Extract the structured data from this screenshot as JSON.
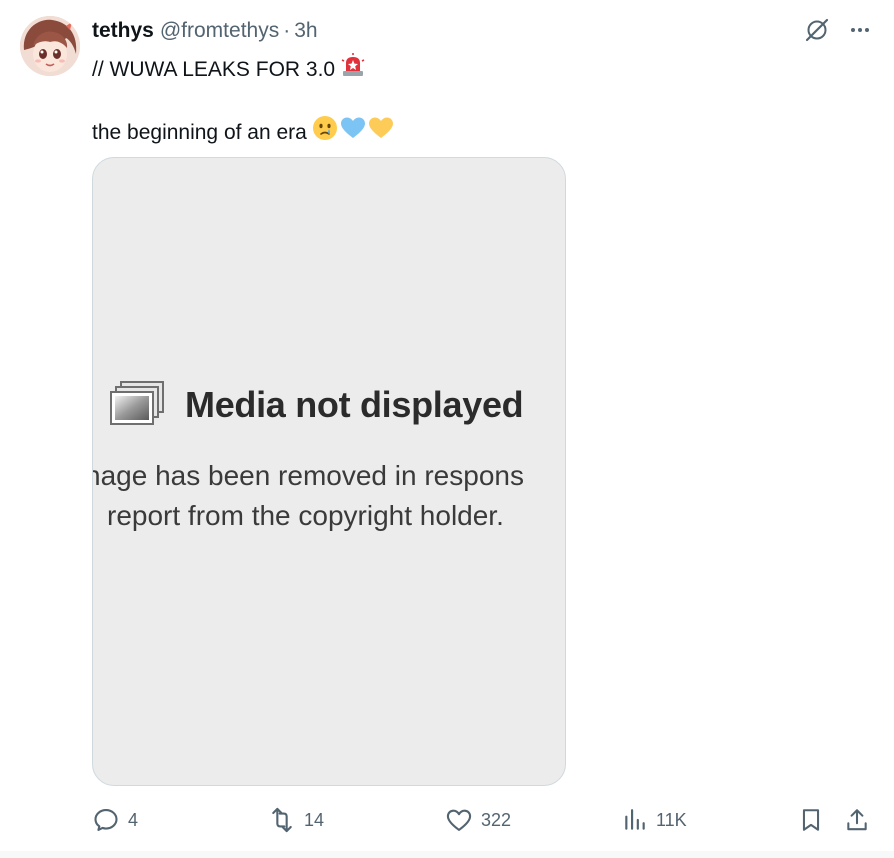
{
  "user": {
    "display_name": "tethys",
    "handle": "@fromtethys",
    "separator": "·",
    "time": "3h",
    "avatar_icon": "anime-avatar"
  },
  "top_actions": {
    "grok_icon": "grok-icon",
    "more_icon": "more-icon"
  },
  "tweet": {
    "line1": "// WUWA LEAKS FOR 3.0",
    "line1_emoji": "police-light-emoji",
    "line2": "the beginning of an era",
    "line2_emojis": [
      "holding-back-tears-emoji",
      "blue-heart-emoji",
      "yellow-heart-emoji"
    ]
  },
  "media": {
    "title": "Media not displayed",
    "line1": "nage has been removed in respons",
    "line2": "report from the copyright holder.",
    "background": "#ececec"
  },
  "actions": {
    "replies": "4",
    "retweets": "14",
    "likes": "322",
    "views": "11K"
  },
  "colors": {
    "text_primary": "#0f1419",
    "text_secondary": "#536471",
    "border": "#cfd9de"
  }
}
